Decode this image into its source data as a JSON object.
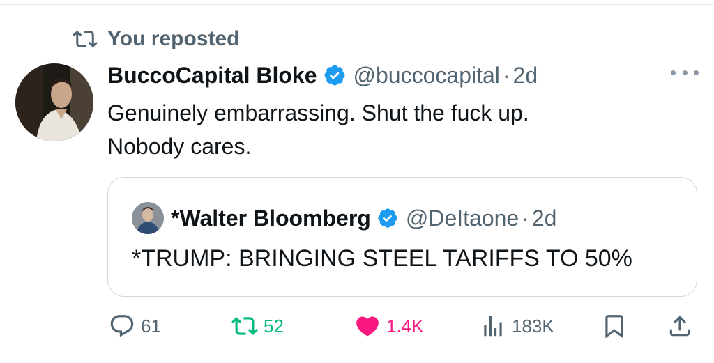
{
  "repost_context": {
    "label": "You reposted",
    "icon": "repost-icon"
  },
  "tweet": {
    "author_name": "BuccoCapital Bloke",
    "handle": "@buccocapital",
    "separator": "·",
    "time": "2d",
    "text_lines": [
      "Genuinely embarrassing. Shut the fuck up.",
      "Nobody cares."
    ],
    "verified_icon": "verified-badge-icon",
    "more_icon": "more-icon"
  },
  "quoted_tweet": {
    "author_name": "*Walter Bloomberg",
    "handle": "@DeItaone",
    "separator": "·",
    "time": "2d",
    "text": "*TRUMP: BRINGING STEEL TARIFFS TO 50%"
  },
  "actions": {
    "replies": "61",
    "reposts": "52",
    "likes": "1.4K",
    "views": "183K"
  },
  "colors": {
    "verified": "#1d9bf0",
    "repost_active": "#00ba7c",
    "like_active": "#f91880",
    "secondary_text": "#536471"
  }
}
